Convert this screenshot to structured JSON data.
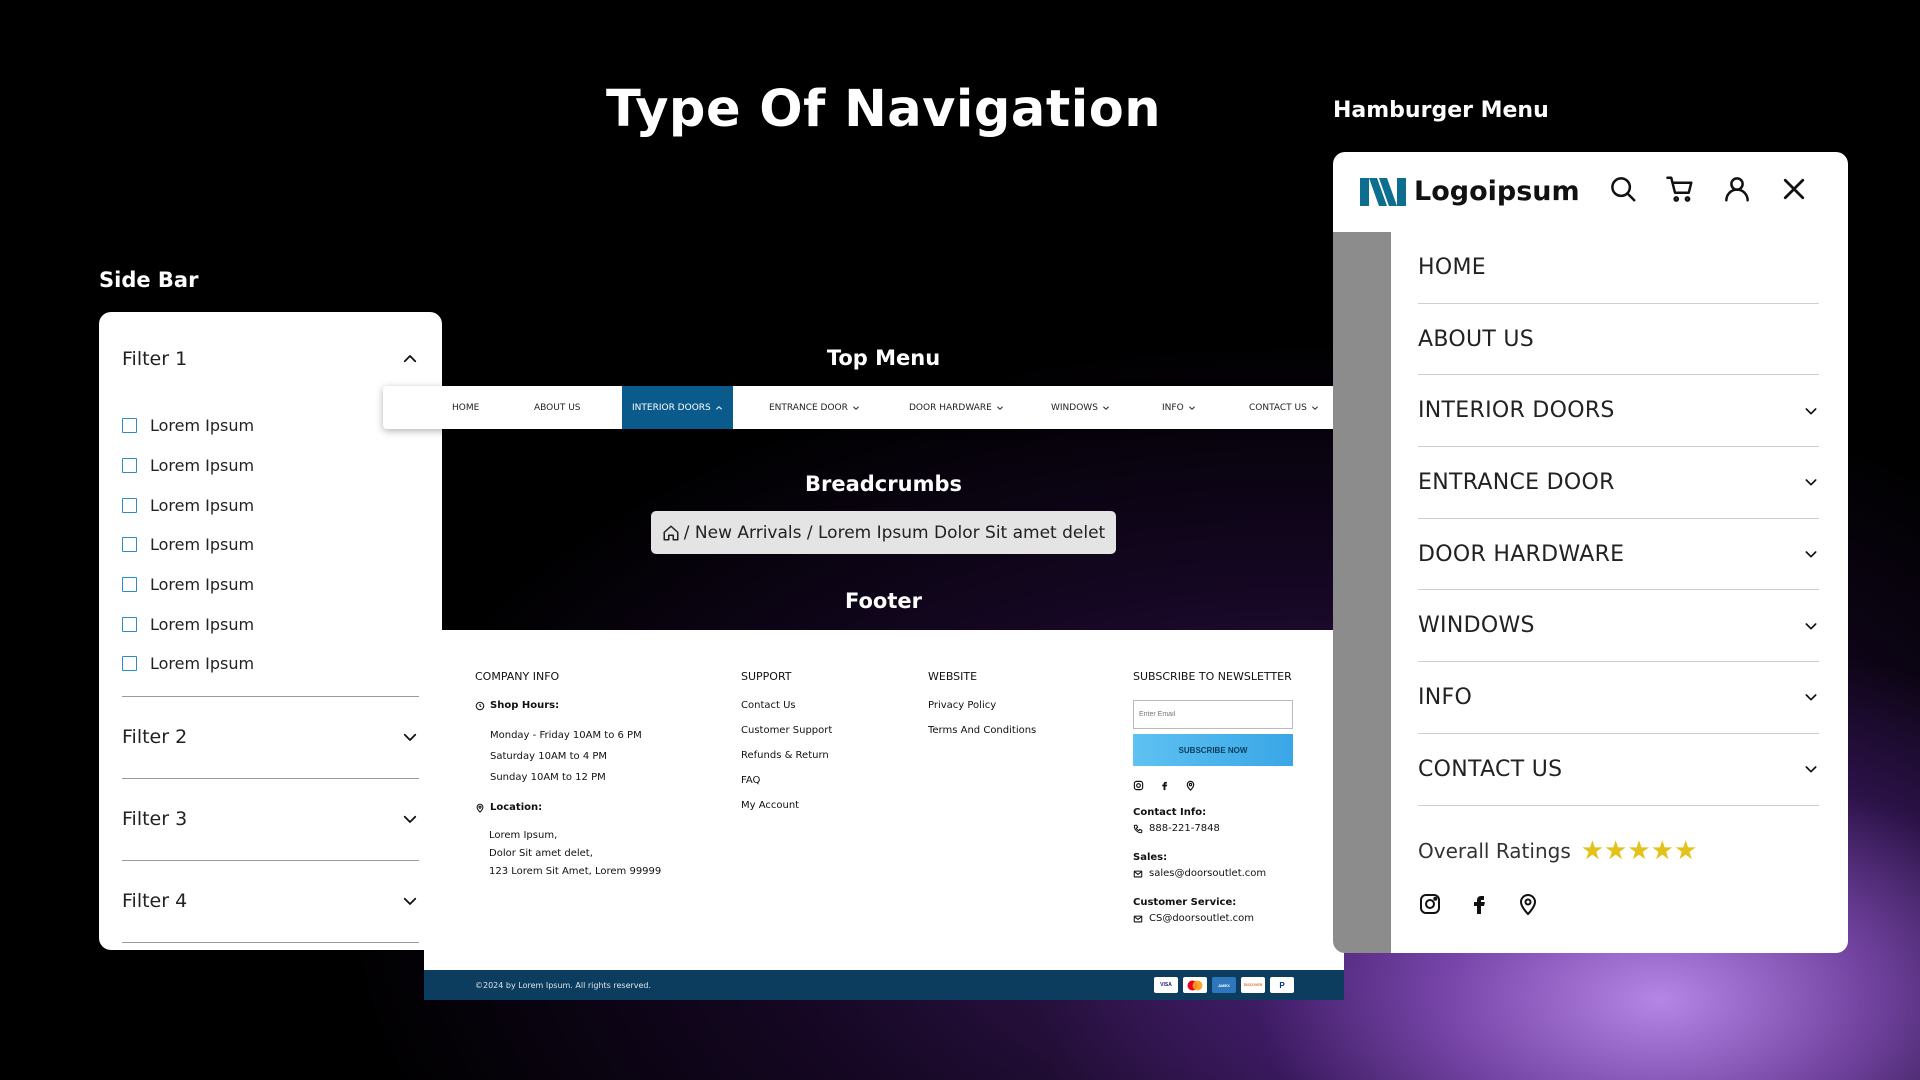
{
  "page_title": "Type Of Navigation",
  "labels": {
    "hamburger": "Hamburger Menu",
    "sidebar": "Side Bar",
    "top_menu": "Top Menu",
    "breadcrumbs": "Breadcrumbs",
    "footer": "Footer"
  },
  "colors": {
    "accent_blue": "#0a5a8c",
    "footer_bar": "#0d3d5e",
    "star": "#e2c21b",
    "checkbox": "#2e8bc9"
  },
  "sidebar": {
    "filter1": {
      "title": "Filter 1",
      "expanded": true,
      "items": [
        "Lorem Ipsum",
        "Lorem Ipsum",
        "Lorem Ipsum",
        "Lorem Ipsum",
        "Lorem Ipsum",
        "Lorem Ipsum",
        "Lorem Ipsum"
      ]
    },
    "filter2": "Filter 2",
    "filter3": "Filter 3",
    "filter4": "Filter 4"
  },
  "top_menu": {
    "items": [
      "HOME",
      "ABOUT US",
      "INTERIOR DOORS",
      "ENTRANCE DOOR",
      "DOOR HARDWARE",
      "WINDOWS",
      "INFO",
      "CONTACT US"
    ],
    "active": "INTERIOR DOORS"
  },
  "breadcrumb": {
    "home_icon": "home-icon",
    "path": "/ New Arrivals / Lorem Ipsum Dolor Sit amet delet"
  },
  "footer": {
    "company": {
      "heading": "COMPANY INFO",
      "hours_label": "Shop Hours:",
      "hours": [
        "Monday - Friday 10AM to 6 PM",
        "Saturday 10AM to 4 PM",
        "Sunday 10AM to 12 PM"
      ],
      "location_label": "Location:",
      "address": [
        "Lorem Ipsum,",
        "Dolor Sit amet delet,",
        "123 Lorem Sit Amet, Lorem 99999"
      ]
    },
    "support": {
      "heading": "SUPPORT",
      "links": [
        "Contact Us",
        "Customer Support",
        "Refunds & Return",
        "FAQ",
        "My Account"
      ]
    },
    "website": {
      "heading": "WEBSITE",
      "links": [
        "Privacy Policy",
        "Terms And Conditions"
      ]
    },
    "newsletter": {
      "heading": "SUBSCRIBE TO NEWSLETTER",
      "placeholder": "Enter Email",
      "button": "SUBSCRIBE NOW",
      "contact_label": "Contact Info:",
      "phone": "888-221-7848",
      "sales_label": "Sales:",
      "sales_email": "sales@doorsoutlet.com",
      "service_label": "Customer Service:",
      "service_email": "CS@doorsoutlet.com"
    },
    "copyright": "©2024 by Lorem Ipsum. All rights reserved.",
    "cards": [
      "VISA",
      "MC",
      "AMEX",
      "DISCOVER",
      "P"
    ]
  },
  "hamburger": {
    "logo": "Logoipsum",
    "menu": [
      "HOME",
      "ABOUT US",
      "INTERIOR DOORS",
      "ENTRANCE DOOR",
      "DOOR HARDWARE",
      "WINDOWS",
      "INFO",
      "CONTACT US"
    ],
    "ratings_label": "Overall Ratings",
    "rating": 5,
    "stars": "★★★★★"
  }
}
